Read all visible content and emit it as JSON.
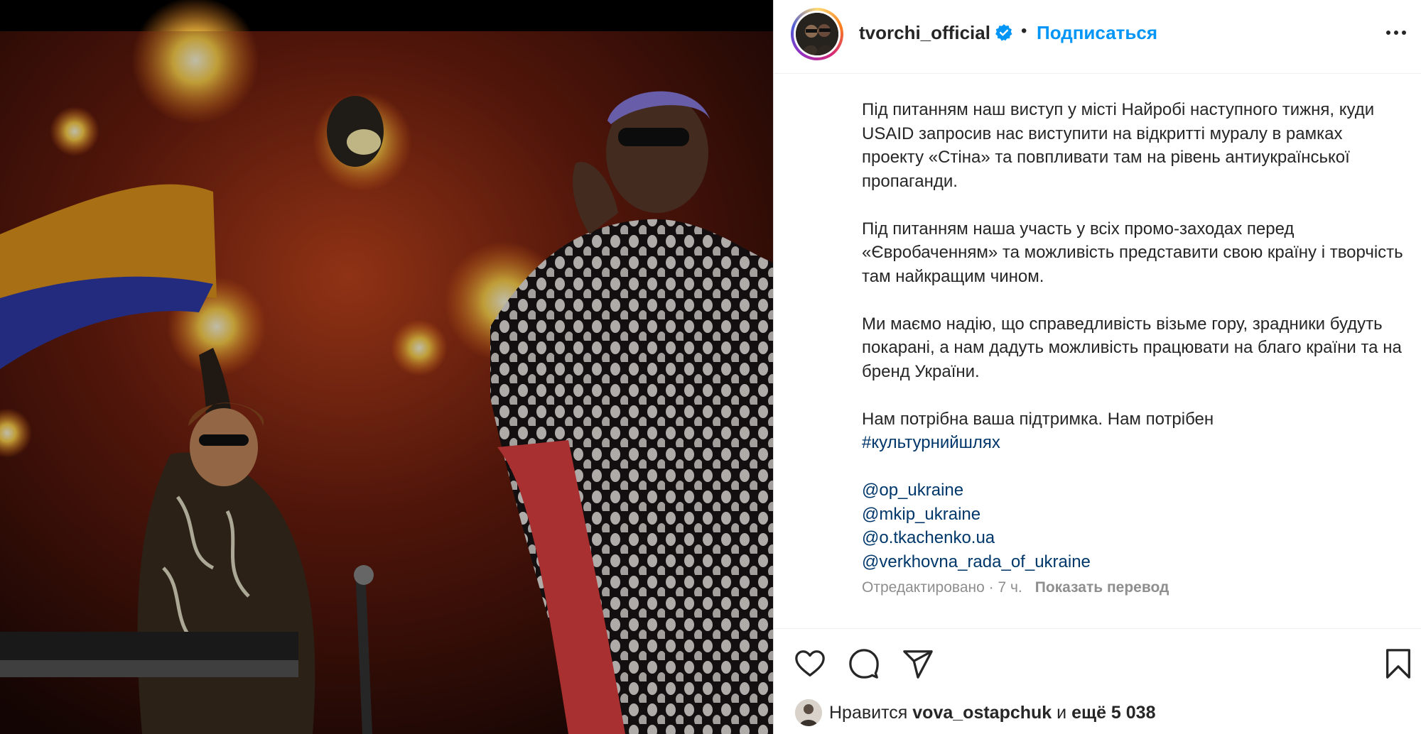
{
  "post": {
    "photo_alt": "concert-photo",
    "icons": {
      "verified": "verified-badge-icon",
      "more": "more-options-icon",
      "like": "heart-icon",
      "comment": "comment-icon",
      "share": "share-icon",
      "save": "bookmark-icon"
    }
  },
  "header": {
    "username": "tvorchi_official",
    "separator": "•",
    "follow_label": "Подписаться"
  },
  "caption": {
    "paragraphs": [
      "Під питанням наш виступ у місті Найробі наступного тижня, куди USAID запросив нас виступити на відкритті муралу в рамках проекту «Стіна» та повпливати там на рівень антиукраїнської пропаганди.",
      "Під питанням наша участь у всіх промо-заходах перед «Євробаченням» та можливість представити свою країну і творчість там найкращим чином.",
      "Ми маємо надію, що справедливість візьме гору, зрадники будуть покарані, а нам дадуть можливість працювати на благо країни та на бренд України."
    ],
    "support_text": "Нам потрібна ваша підтримка. Нам потрібен",
    "hashtag": "#культурнийшлях",
    "mentions": [
      "@op_ukraine",
      "@mkip_ukraine",
      "@o.tkachenko.ua",
      "@verkhovna_rada_of_ukraine"
    ]
  },
  "meta": {
    "edited": "Отредактировано · 7 ч.",
    "translate_label": "Показать перевод"
  },
  "likes": {
    "prefix": "Нравится",
    "user": "vova_ostapchuk",
    "conjunction": "и",
    "rest": "ещё 5 038"
  },
  "colors": {
    "accent": "#0095f6",
    "link": "#00376b",
    "muted": "#8e8e8e"
  }
}
